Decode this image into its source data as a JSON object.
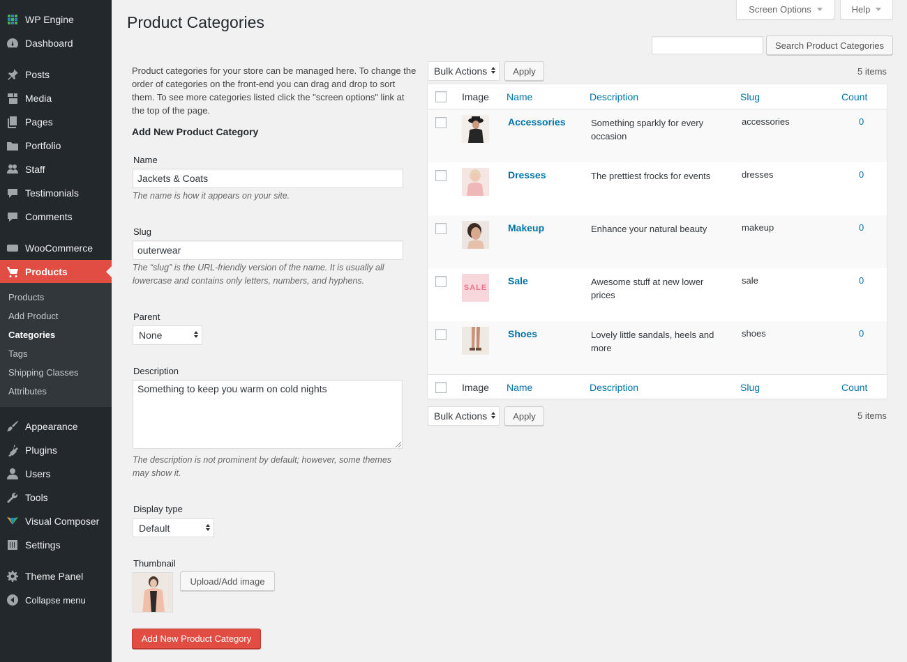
{
  "sidebar": {
    "menu": [
      {
        "label": "WP Engine",
        "icon": "grid-icon"
      },
      {
        "label": "Dashboard",
        "icon": "gauge-icon"
      },
      {
        "label": "Posts",
        "icon": "pin-icon"
      },
      {
        "label": "Media",
        "icon": "media-icon"
      },
      {
        "label": "Pages",
        "icon": "pages-icon"
      },
      {
        "label": "Portfolio",
        "icon": "folder-icon"
      },
      {
        "label": "Staff",
        "icon": "group-icon"
      },
      {
        "label": "Testimonials",
        "icon": "speech-bubble-icon"
      },
      {
        "label": "Comments",
        "icon": "comment-icon"
      },
      {
        "label": "WooCommerce",
        "icon": "woo-icon"
      },
      {
        "label": "Products",
        "icon": "cart-icon"
      },
      {
        "label": "Appearance",
        "icon": "brush-icon"
      },
      {
        "label": "Plugins",
        "icon": "plug-icon"
      },
      {
        "label": "Users",
        "icon": "user-icon"
      },
      {
        "label": "Tools",
        "icon": "wrench-icon"
      },
      {
        "label": "Visual Composer",
        "icon": "vc-icon"
      },
      {
        "label": "Settings",
        "icon": "sliders-icon"
      },
      {
        "label": "Theme Panel",
        "icon": "gear-icon"
      },
      {
        "label": "Collapse menu",
        "icon": "collapse-icon"
      }
    ],
    "submenu": [
      "Products",
      "Add Product",
      "Categories",
      "Tags",
      "Shipping Classes",
      "Attributes"
    ],
    "active_color": "#e14d43",
    "bg_color": "#23282d"
  },
  "top": {
    "screen_options": "Screen Options",
    "help": "Help"
  },
  "page": {
    "title": "Product Categories",
    "search_button": "Search Product Categories",
    "search_value": ""
  },
  "form": {
    "intro": "Product categories for your store can be managed here. To change the order of categories on the front-end you can drag and drop to sort them. To see more categories listed click the \"screen options\" link at the top of the page.",
    "heading": "Add New Product Category",
    "name_label": "Name",
    "name_value": "Jackets & Coats",
    "name_help": "The name is how it appears on your site.",
    "slug_label": "Slug",
    "slug_value": "outerwear",
    "slug_help": "The “slug” is the URL-friendly version of the name. It is usually all lowercase and contains only letters, numbers, and hyphens.",
    "parent_label": "Parent",
    "parent_value": "None",
    "description_label": "Description",
    "description_value": "Something to keep you warm on cold nights",
    "description_help": "The description is not prominent by default; however, some themes may show it.",
    "display_type_label": "Display type",
    "display_type_value": "Default",
    "thumbnail_label": "Thumbnail",
    "upload_button": "Upload/Add image",
    "submit_button": "Add New Product Category"
  },
  "table": {
    "bulk_actions": "Bulk Actions",
    "apply": "Apply",
    "items_count": "5 items",
    "headers": {
      "image": "Image",
      "name": "Name",
      "description": "Description",
      "slug": "Slug",
      "count": "Count"
    },
    "rows": [
      {
        "name": "Accessories",
        "description": "Something sparkly for every occasion",
        "slug": "accessories",
        "count": "0"
      },
      {
        "name": "Dresses",
        "description": "The prettiest frocks for events",
        "slug": "dresses",
        "count": "0"
      },
      {
        "name": "Makeup",
        "description": "Enhance your natural beauty",
        "slug": "makeup",
        "count": "0"
      },
      {
        "name": "Sale",
        "description": "Awesome stuff at new lower prices",
        "slug": "sale",
        "count": "0",
        "thumb_text": "SALE"
      },
      {
        "name": "Shoes",
        "description": "Lovely little sandals, heels and more",
        "slug": "shoes",
        "count": "0"
      }
    ],
    "link_color": "#0073aa"
  }
}
